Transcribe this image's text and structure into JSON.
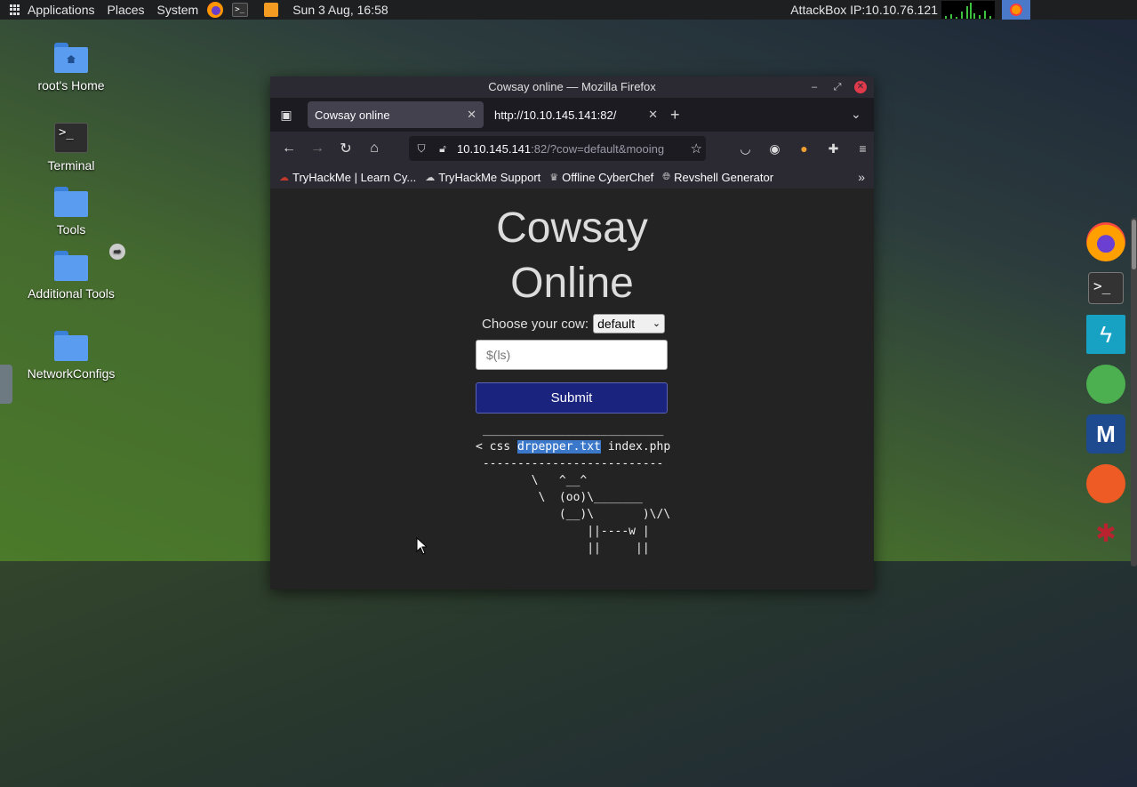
{
  "top_panel": {
    "applications": "Applications",
    "places": "Places",
    "system": "System",
    "datetime": "Sun 3 Aug, 16:58",
    "attackbox_ip": "AttackBox IP:10.10.76.121"
  },
  "desktop": {
    "icons": [
      {
        "label": "root's Home"
      },
      {
        "label": "Terminal"
      },
      {
        "label": "Tools"
      },
      {
        "label": "Additional Tools"
      },
      {
        "label": "NetworkConfigs"
      }
    ]
  },
  "window": {
    "title": "Cowsay online — Mozilla Firefox",
    "tabs": [
      {
        "label": "Cowsay online",
        "active": true
      },
      {
        "label": "http://10.10.145.141:82/",
        "active": false
      }
    ],
    "url_host": "10.10.145.141",
    "url_rest": ":82/?cow=default&mooing",
    "bookmarks": [
      {
        "label": "TryHackMe | Learn Cy..."
      },
      {
        "label": "TryHackMe Support"
      },
      {
        "label": "Offline CyberChef"
      },
      {
        "label": "Revshell Generator"
      }
    ]
  },
  "page": {
    "title_line1": "Cowsay",
    "title_line2": "Online",
    "choose_label": "Choose your cow:",
    "cow_selected": "default",
    "input_placeholder": "$(ls)",
    "submit_label": "Submit",
    "cow_top_border": " __________________________",
    "cow_line_prefix": "< css ",
    "cow_highlight": "drpepper.txt",
    "cow_line_suffix": " index.php",
    "cow_bottom_border": " --------------------------",
    "cow_art": "        \\   ^__^\n         \\  (oo)\\_______\n            (__)\\       )\\/\\\n                ||----w |\n                ||     ||"
  },
  "colors": {
    "submit_bg": "#1a237e",
    "highlight": "#3b78c9",
    "close_button": "#e03a4b"
  }
}
